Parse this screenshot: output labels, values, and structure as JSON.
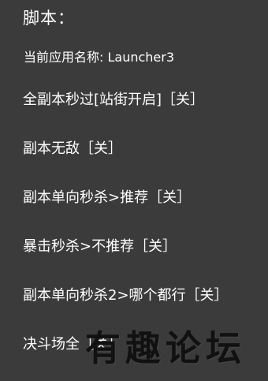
{
  "header": {
    "title": "脚本：",
    "current_app": "当前应用名称: Launcher3"
  },
  "menu": [
    {
      "label": "全副本秒过[站街开启]［关］"
    },
    {
      "label": "副本无敌［关］"
    },
    {
      "label": "副本单向秒杀>推荐［关］"
    },
    {
      "label": "暴击秒杀>不推荐［关］"
    },
    {
      "label": "副本单向秒杀2>哪个都行［关］"
    },
    {
      "label": "决斗场全［关］"
    }
  ],
  "watermark": {
    "text": "有趣论坛"
  }
}
